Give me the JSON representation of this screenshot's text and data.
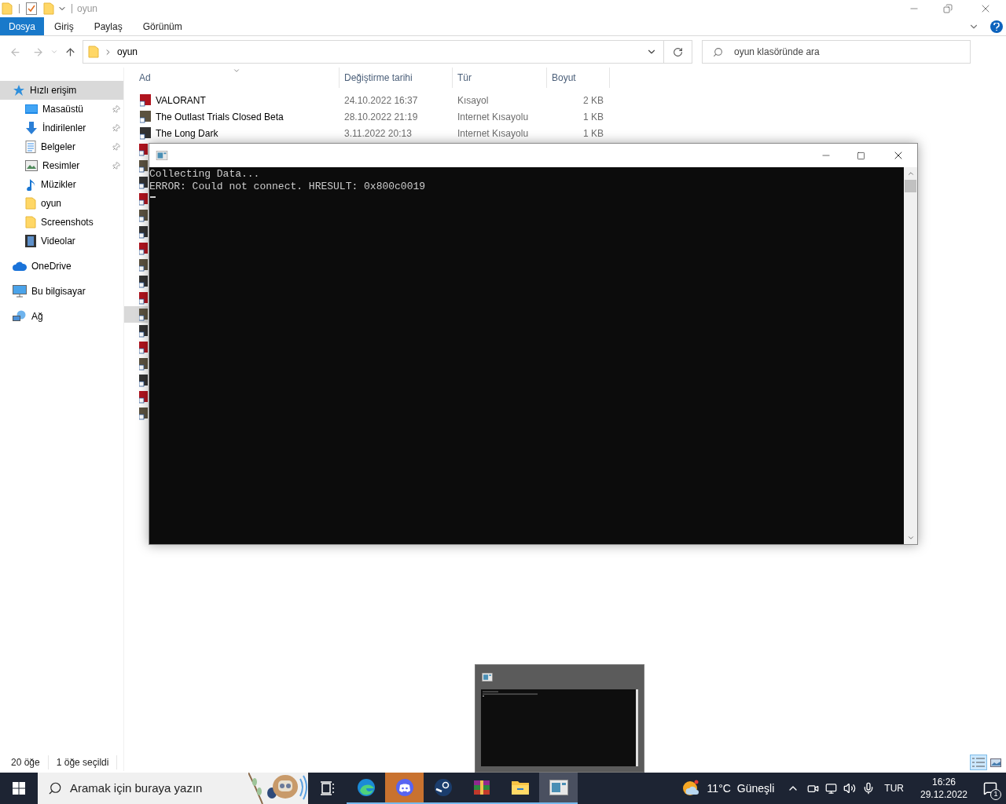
{
  "window": {
    "title": "oyun"
  },
  "ribbon_tabs": [
    {
      "label": "Dosya",
      "kind": "file"
    },
    {
      "label": "Giriş",
      "kind": "tab"
    },
    {
      "label": "Paylaş",
      "kind": "tab"
    },
    {
      "label": "Görünüm",
      "kind": "tab"
    }
  ],
  "address": {
    "path": "oyun"
  },
  "search": {
    "placeholder": "oyun klasöründe ara"
  },
  "sidebar": {
    "items": [
      {
        "label": "Hızlı erişim",
        "kind": "quick",
        "selected": true,
        "pinned": false,
        "children": [
          {
            "label": "Masaüstü",
            "kind": "desktop",
            "selected": false,
            "pinned": true
          },
          {
            "label": "İndirilenler",
            "kind": "downloads",
            "selected": false,
            "pinned": true
          },
          {
            "label": "Belgeler",
            "kind": "documents",
            "selected": false,
            "pinned": true
          },
          {
            "label": "Resimler",
            "kind": "pictures",
            "selected": false,
            "pinned": true
          },
          {
            "label": "Müzikler",
            "kind": "music",
            "selected": false,
            "pinned": false
          },
          {
            "label": "oyun",
            "kind": "folder",
            "selected": false,
            "pinned": false
          },
          {
            "label": "Screenshots",
            "kind": "folder",
            "selected": false,
            "pinned": false
          },
          {
            "label": "Videolar",
            "kind": "videos",
            "selected": false,
            "pinned": false
          }
        ]
      },
      {
        "label": "OneDrive",
        "kind": "cloud",
        "selected": false,
        "pinned": false
      },
      {
        "label": "Bu bilgisayar",
        "kind": "computer",
        "selected": false,
        "pinned": false
      },
      {
        "label": "Ağ",
        "kind": "network",
        "selected": false,
        "pinned": false
      }
    ]
  },
  "table": {
    "columns": [
      "Ad",
      "Değiştirme tarihi",
      "Tür",
      "Boyut"
    ],
    "rows": [
      {
        "name": "VALORANT",
        "date": "24.10.2022 16:37",
        "type": "Kısayol",
        "size": "2 KB",
        "selected": false
      },
      {
        "name": "The Outlast Trials Closed Beta",
        "date": "28.10.2022 21:19",
        "type": "Internet Kısayolu",
        "size": "1 KB",
        "selected": false
      },
      {
        "name": "The Long Dark",
        "date": "3.11.2022 20:13",
        "type": "Internet Kısayolu",
        "size": "1 KB",
        "selected": false
      }
    ],
    "obscured_rows": [
      {
        "selected": false
      },
      {
        "selected": false
      },
      {
        "selected": false
      },
      {
        "selected": false
      },
      {
        "selected": false
      },
      {
        "selected": false
      },
      {
        "selected": false
      },
      {
        "selected": false
      },
      {
        "selected": false
      },
      {
        "selected": false
      },
      {
        "selected": true
      },
      {
        "selected": false
      },
      {
        "selected": false
      },
      {
        "selected": false
      },
      {
        "selected": false
      },
      {
        "selected": false
      },
      {
        "selected": false
      }
    ]
  },
  "status_bar": {
    "count": "20 öğe",
    "selection": "1 öğe seçildi"
  },
  "console": {
    "lines": [
      "Collecting Data...",
      "ERROR: Could not connect. HRESULT: 0x800c0019"
    ]
  },
  "taskbar": {
    "search_placeholder": "Aramak için buraya yazın",
    "apps": [
      {
        "kind": "taskview",
        "running": false,
        "active": false
      },
      {
        "kind": "edge",
        "running": true,
        "active": false
      },
      {
        "kind": "discord",
        "running": true,
        "active": true
      },
      {
        "kind": "steam",
        "running": true,
        "active": false
      },
      {
        "kind": "winrar",
        "running": true,
        "active": false
      },
      {
        "kind": "explorer",
        "running": true,
        "active": false
      },
      {
        "kind": "console",
        "running": true,
        "active": false
      }
    ],
    "weather": {
      "temp": "11°C",
      "condition": "Güneşli"
    },
    "language": "TUR",
    "time": "16:26",
    "date": "29.12.2022",
    "notifications": "1"
  }
}
